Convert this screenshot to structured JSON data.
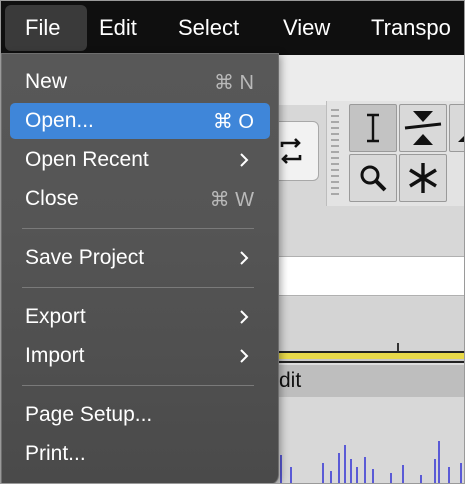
{
  "menubar": {
    "items": [
      "File",
      "Edit",
      "Select",
      "View",
      "Transpo"
    ]
  },
  "file_menu": {
    "items": [
      {
        "label": "New",
        "shortcut": "⌘ N"
      },
      {
        "label": "Open...",
        "shortcut": "⌘ O",
        "highlighted": true
      },
      {
        "label": "Open Recent",
        "submenu": true
      },
      {
        "label": "Close",
        "shortcut": "⌘ W"
      },
      {
        "label": "Save Project",
        "submenu": true
      },
      {
        "label": "Export",
        "submenu": true
      },
      {
        "label": "Import",
        "submenu": true
      },
      {
        "label": "Page Setup..."
      },
      {
        "label": "Print..."
      }
    ]
  },
  "track": {
    "label_fragment": "dit"
  },
  "colors": {
    "menubar_bg": "#0f0f0f",
    "menu_bg": "#555555",
    "highlight": "#3f86d9",
    "waveform": "#3b3bd6"
  },
  "icons": [
    "selection-tool-icon",
    "envelope-tool-icon",
    "zoom-tool-icon",
    "multi-tool-icon",
    "loop-icon",
    "chevron-right-icon"
  ]
}
